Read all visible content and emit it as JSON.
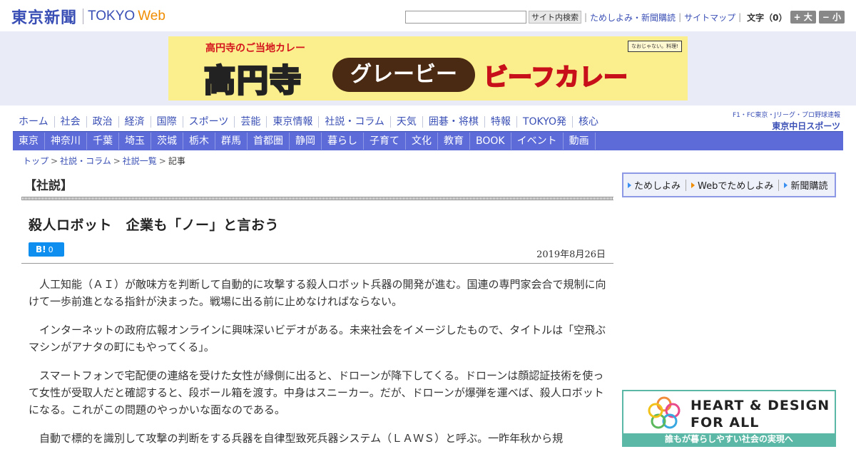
{
  "header": {
    "logo_jp": "東京新聞",
    "logo_tokyo": "TOKYO",
    "logo_web": "Web",
    "search": {
      "value": "",
      "button_label": "サイト内検索"
    },
    "links": [
      "ためしよみ・新聞購読",
      "サイトマップ"
    ],
    "font_size_label": "文字（0）",
    "size_up_label": "+ 大",
    "size_down_label": "− 小"
  },
  "banner": {
    "top_line": "高円寺のご当地カレー",
    "badge": "なおじゃない。料理!",
    "kanji": "高円寺",
    "pill": "グレービー",
    "curry": "ビーフカレー"
  },
  "nav_primary": [
    "ホーム",
    "社会",
    "政治",
    "経済",
    "国際",
    "スポーツ",
    "芸能",
    "東京情報",
    "社説・コラム",
    "天気",
    "囲碁・将棋",
    "特報",
    "TOKYO発",
    "核心"
  ],
  "sports": {
    "top": "F1・FC東京・Jリーグ・プロ野球速報",
    "logo": "東京中日スポーツ"
  },
  "nav_secondary": [
    "東京",
    "神奈川",
    "千葉",
    "埼玉",
    "茨城",
    "栃木",
    "群馬",
    "首都圏",
    "静岡",
    "暮らし",
    "子育て",
    "文化",
    "教育",
    "BOOK",
    "イベント",
    "動画"
  ],
  "breadcrumb": [
    "トップ",
    "社説・コラム",
    "社説一覧",
    "記事"
  ],
  "article": {
    "category": "【社説】",
    "headline": "殺人ロボット　企業も「ノー」と言おう",
    "hatena_label": "B!",
    "hatena_count": "0",
    "date": "2019年8月26日",
    "paragraphs": [
      "人工知能（ＡＩ）が敵味方を判断して自動的に攻撃する殺人ロボット兵器の開発が進む。国連の専門家会合で規制に向けて一歩前進となる指針が決まった。戦場に出る前に止めなければならない。",
      "インターネットの政府広報オンラインに興味深いビデオがある。未来社会をイメージしたもので、タイトルは「空飛ぶマシンがアナタの町にもやってくる」。",
      "スマートフォンで宅配便の連絡を受けた女性が縁側に出ると、ドローンが降下してくる。ドローンは顔認証技術を使って女性が受取人だと確認すると、段ボール箱を渡す。中身はスニーカー。だが、ドローンが爆弾を運べば、殺人ロボットになる。これがこの問題のやっかいな面なのである。",
      "自動で標的を識別して攻撃の判断をする兵器を自律型致死兵器システム（ＬＡＷＳ）と呼ぶ。一昨年秋から規"
    ]
  },
  "side": {
    "links": [
      "ためしよみ",
      "Webでためしよみ",
      "新聞購読"
    ]
  },
  "heart_ad": {
    "title1": "HEART & DESIGN",
    "title2": "FOR ALL",
    "foot": "誰もが暮らしやすい社会の実現へ"
  }
}
